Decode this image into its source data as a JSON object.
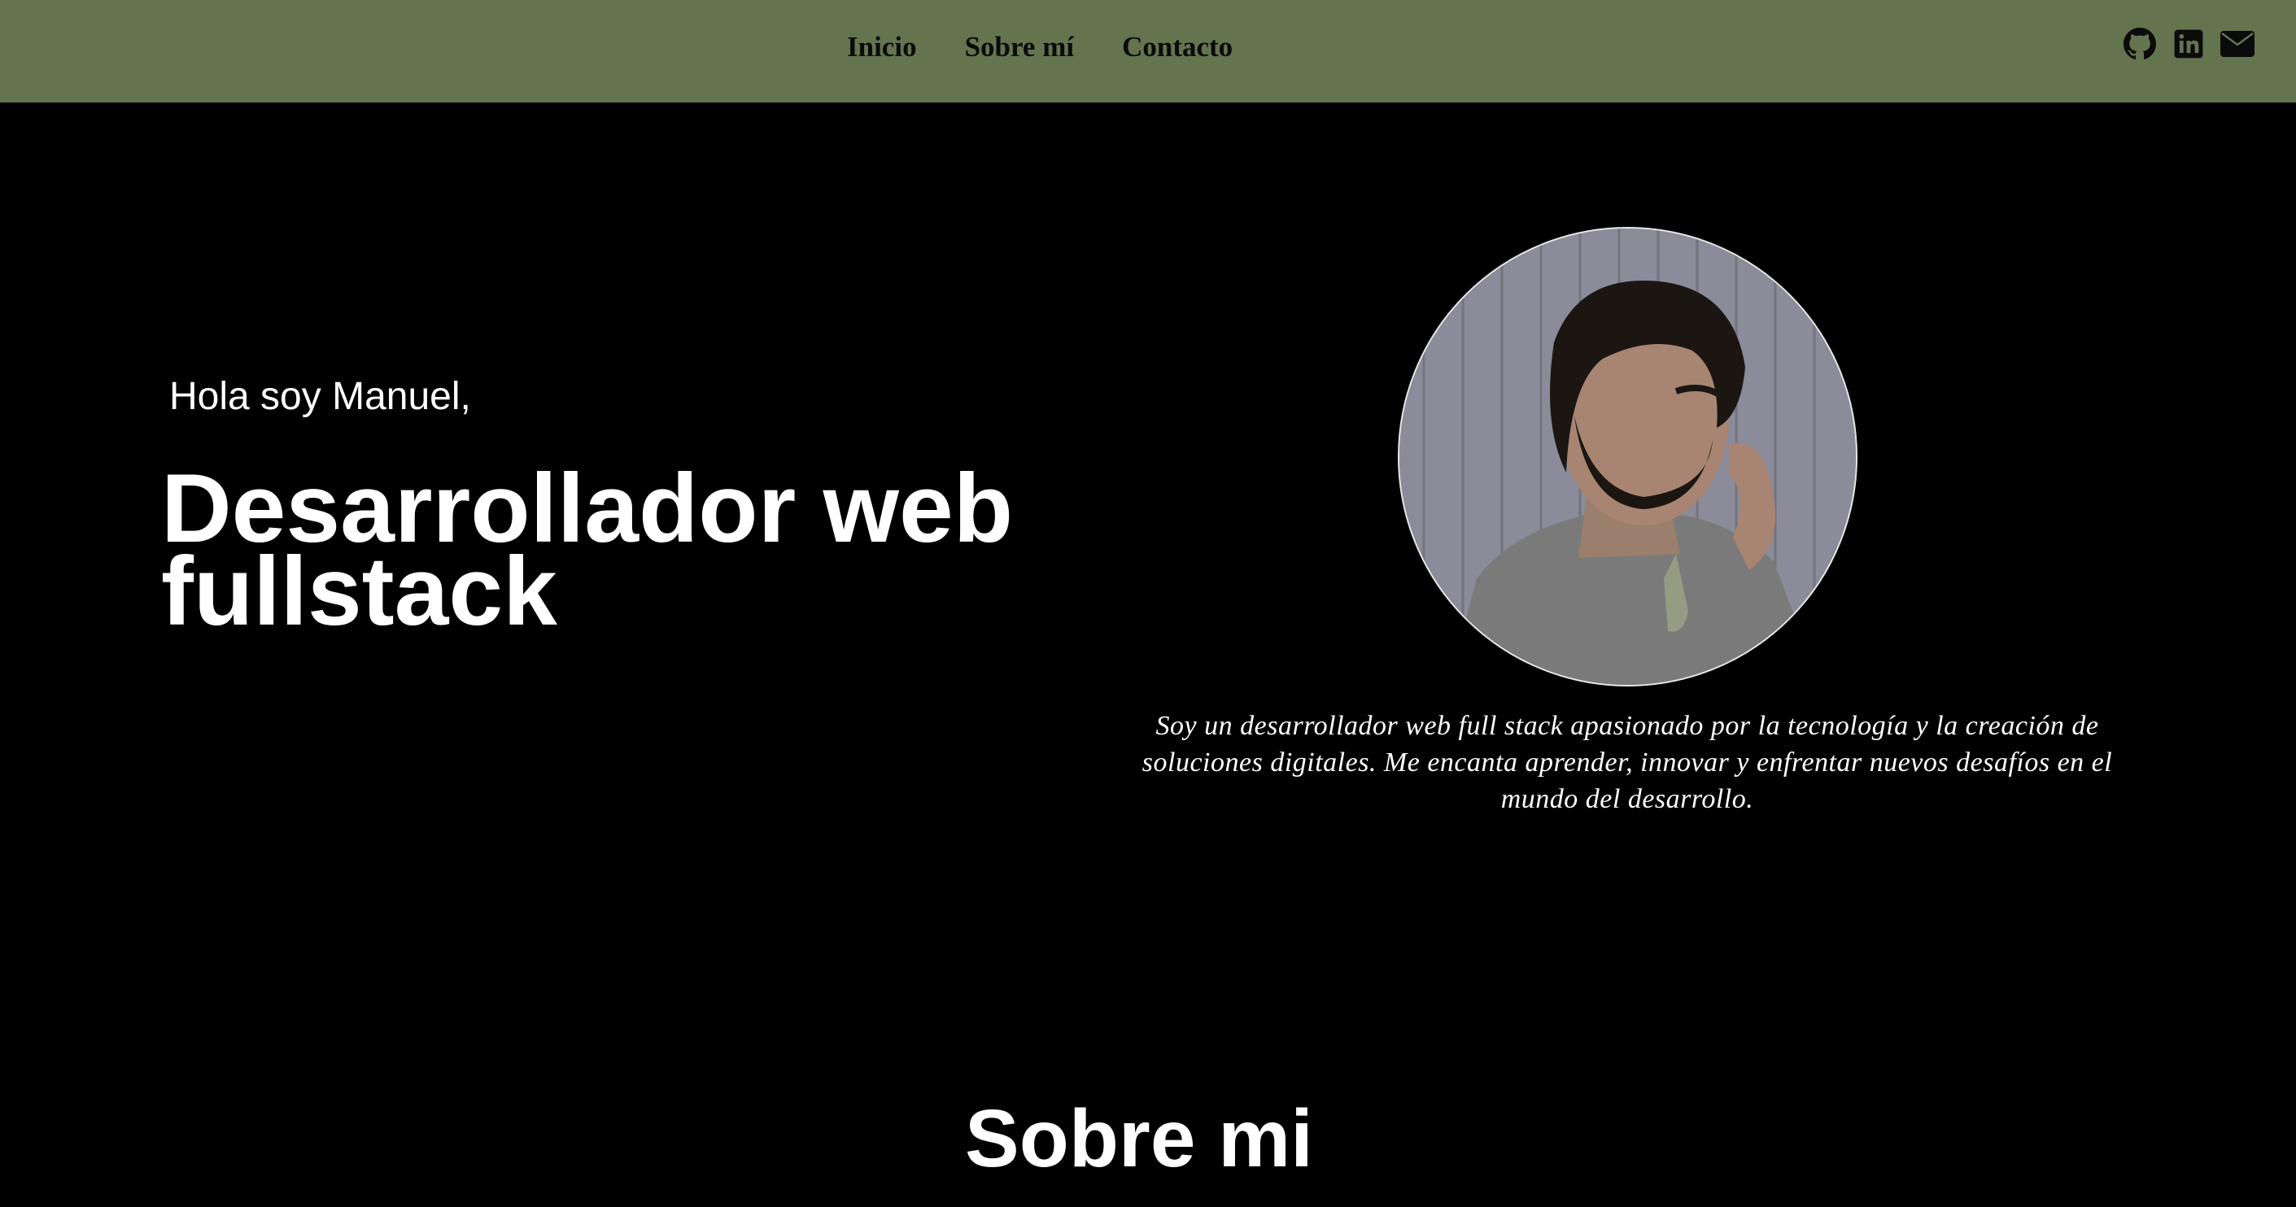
{
  "nav": {
    "links": [
      {
        "label": "Inicio"
      },
      {
        "label": "Sobre mí"
      },
      {
        "label": "Contacto"
      }
    ],
    "icons": [
      "github-icon",
      "linkedin-icon",
      "mail-icon"
    ],
    "background_color": "#64744f"
  },
  "hero": {
    "greeting": "Hola soy Manuel,",
    "title": "Desarrollador web fullstack",
    "photo": "profile-photo",
    "bio": "Soy un desarrollador web full stack apasionado por la tecnología y la creación de soluciones digitales. Me encanta aprender, innovar y enfrentar nuevos desafíos en el mundo del desarrollo."
  },
  "about": {
    "title": "Sobre mi"
  },
  "colors": {
    "page_background": "#000000",
    "text": "#ffffff"
  }
}
